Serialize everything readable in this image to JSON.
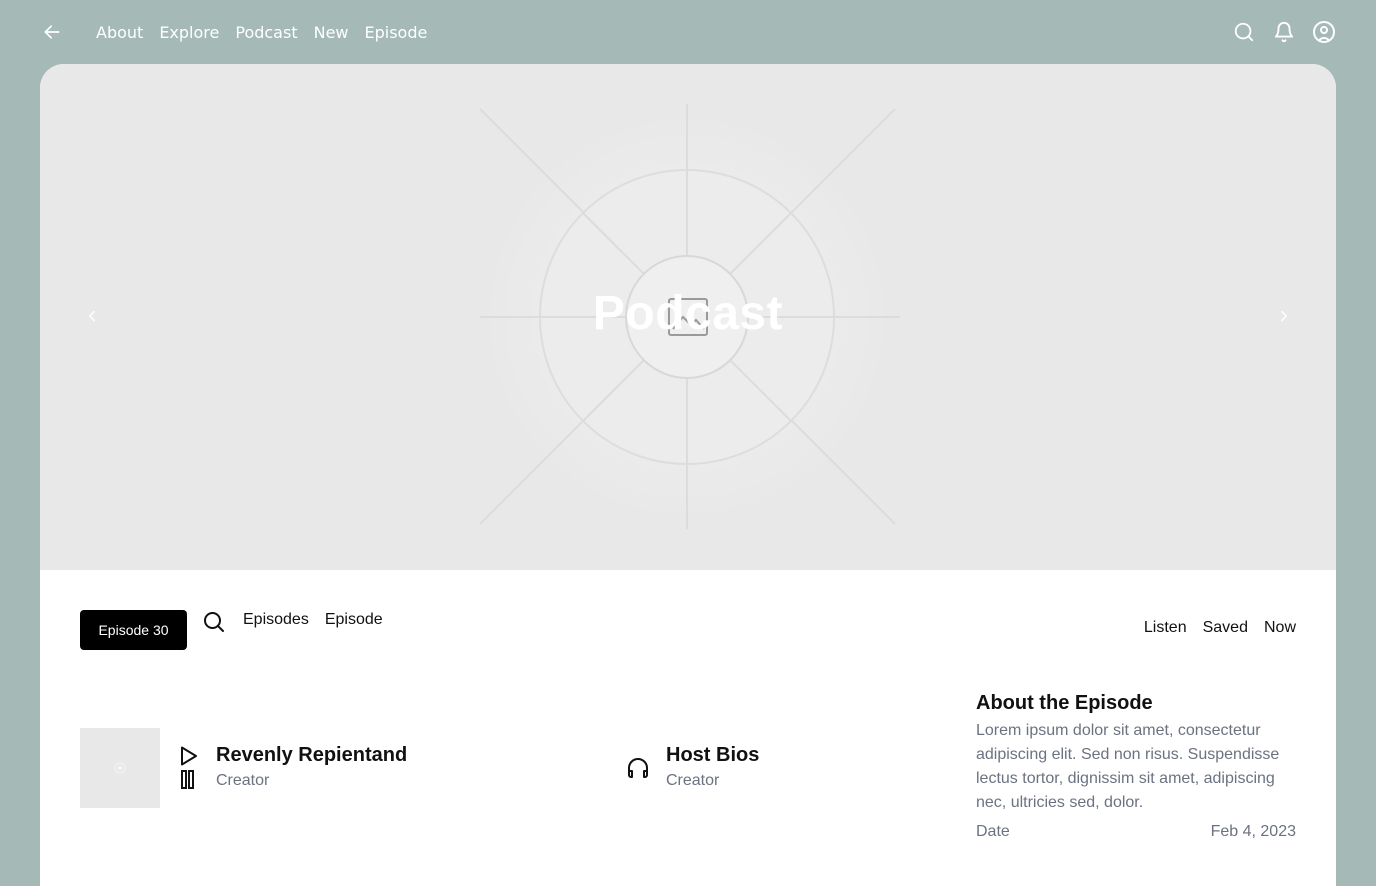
{
  "nav": {
    "links": [
      "About",
      "Explore",
      "Podcast",
      "New",
      "Episode"
    ]
  },
  "hero": {
    "title": "Podcast"
  },
  "toolbar": {
    "episode_badge": "Episode 30",
    "links": [
      "Episodes",
      "Episode"
    ],
    "right_links": [
      "Listen",
      "Saved",
      "Now"
    ]
  },
  "items": [
    {
      "title": "Revenly Repientand",
      "subtitle": "Creator"
    },
    {
      "title": "Host Bios",
      "subtitle": "Creator"
    }
  ],
  "about": {
    "heading": "About the Episode",
    "body": "Lorem ipsum dolor sit amet, consectetur adipiscing elit. Sed non risus. Suspendisse lectus tortor, dignissim sit amet, adipiscing nec, ultricies sed, dolor.",
    "date_label": "Date",
    "date_value": "Feb 4, 2023"
  },
  "colors": {
    "background": "#a5bab7",
    "card": "#ffffff",
    "hero": "#e8e8e8",
    "badge": "#000000",
    "muted_text": "#6b7280"
  },
  "icons": [
    "back-arrow-icon",
    "search-icon",
    "bell-icon",
    "user-circle-icon",
    "chevron-left-icon",
    "chevron-right-icon",
    "image-placeholder-icon",
    "play-icon",
    "pause-icon",
    "headphones-icon"
  ]
}
